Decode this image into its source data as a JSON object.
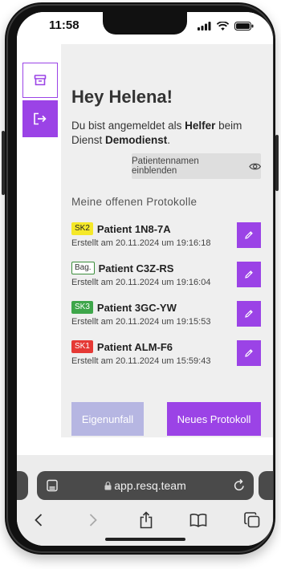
{
  "status_bar": {
    "time": "11:58"
  },
  "sidebar": [
    {
      "icon": "archive-icon"
    },
    {
      "icon": "logout-icon"
    }
  ],
  "header": {
    "greeting": "Hey Helena!",
    "login_prefix": "Du bist angemeldet als ",
    "role": "Helfer",
    "login_middle": " beim Dienst ",
    "service": "Demodienst",
    "login_suffix": "."
  },
  "toggle_names": {
    "label": "Patientennamen einblenden",
    "icon": "eye-icon"
  },
  "section_title": "Meine offenen Protokolle",
  "protocols": [
    {
      "badge": "SK2",
      "badge_bg": "#f5e829",
      "badge_fg": "#222222",
      "badge_border": "#f5e829",
      "name": "Patient 1N8-7A",
      "created": "Erstellt am 20.11.2024 um 19:16:18"
    },
    {
      "badge": "Bag.",
      "badge_bg": "#ffffff",
      "badge_fg": "#333333",
      "badge_border": "#3b8e3b",
      "name": "Patient C3Z-RS",
      "created": "Erstellt am 20.11.2024 um 19:16:04"
    },
    {
      "badge": "SK3",
      "badge_bg": "#3ea64a",
      "badge_fg": "#ffffff",
      "badge_border": "#3ea64a",
      "name": "Patient 3GC-YW",
      "created": "Erstellt am 20.11.2024 um 19:15:53"
    },
    {
      "badge": "SK1",
      "badge_bg": "#e53935",
      "badge_fg": "#ffffff",
      "badge_border": "#e53935",
      "name": "Patient ALM-F6",
      "created": "Erstellt am 20.11.2024 um 15:59:43"
    }
  ],
  "actions": {
    "secondary": "Eigenunfall",
    "primary": "Neues Protokoll"
  },
  "browser": {
    "url": "app.resq.team"
  },
  "colors": {
    "accent": "#9b43e6",
    "disabled": "#b6b6e2",
    "content_bg": "#efefef"
  }
}
